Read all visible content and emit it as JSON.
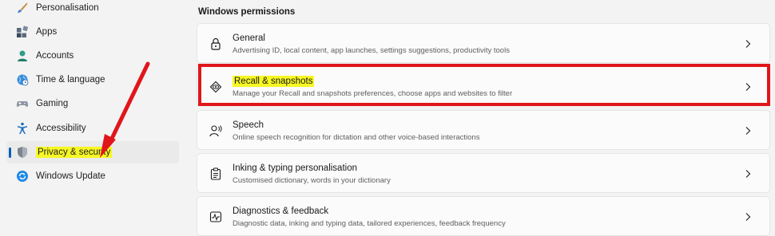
{
  "sidebar": {
    "items": [
      {
        "label": "Personalisation",
        "icon": "brush-icon"
      },
      {
        "label": "Apps",
        "icon": "apps-icon"
      },
      {
        "label": "Accounts",
        "icon": "person-icon"
      },
      {
        "label": "Time & language",
        "icon": "globe-clock-icon"
      },
      {
        "label": "Gaming",
        "icon": "gamepad-icon"
      },
      {
        "label": "Accessibility",
        "icon": "accessibility-icon"
      },
      {
        "label": "Privacy & security",
        "icon": "shield-icon",
        "selected": true
      },
      {
        "label": "Windows Update",
        "icon": "update-icon"
      }
    ]
  },
  "main": {
    "section_title": "Windows permissions",
    "cards": [
      {
        "title": "General",
        "subtitle": "Advertising ID, local content, app launches, settings suggestions, productivity tools",
        "icon": "lock-icon"
      },
      {
        "title": "Recall & snapshots",
        "subtitle": "Manage your Recall and snapshots preferences, choose apps and websites to filter",
        "icon": "recall-icon"
      },
      {
        "title": "Speech",
        "subtitle": "Online speech recognition for dictation and other voice-based interactions",
        "icon": "speech-icon"
      },
      {
        "title": "Inking & typing personalisation",
        "subtitle": "Customised dictionary, words in your dictionary",
        "icon": "clipboard-icon"
      },
      {
        "title": "Diagnostics & feedback",
        "subtitle": "Diagnostic data, inking and typing data, tailored experiences, feedback frequency",
        "icon": "diagnostics-icon"
      }
    ]
  },
  "colors": {
    "highlight": "#f7f724",
    "annotation_red": "#e0161b",
    "accent": "#005fb8"
  }
}
